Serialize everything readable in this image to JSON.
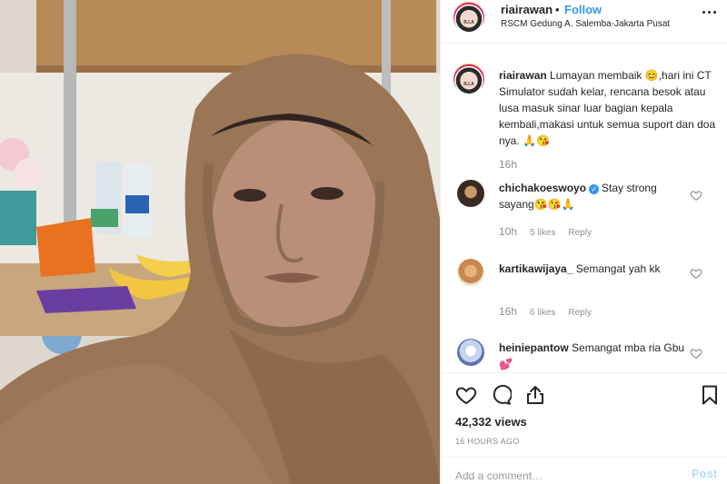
{
  "post": {
    "username": "riairawan",
    "follow_label": "Follow",
    "separator": "•",
    "location": "RSCM Gedung A. Salemba-Jakarta Pusat",
    "avatar_text": "R.I.A"
  },
  "caption": {
    "username": "riairawan",
    "text": "Lumayan membaik 😊,hari ini CT Simulator sudah kelar, rencana besok atau lusa masuk sinar luar bagian kepala kembali,makasi untuk semua suport dan doa nya. 🙏😘",
    "time": "16h"
  },
  "comments": [
    {
      "username": "chichakoeswoyo",
      "verified": true,
      "text": "Stay strong sayang😘😘🙏",
      "time": "10h",
      "likes": "5 likes",
      "reply": "Reply"
    },
    {
      "username": "kartikawijaya_",
      "verified": false,
      "text": "Semangat yah kk",
      "time": "16h",
      "likes": "6 likes",
      "reply": "Reply"
    },
    {
      "username": "heiniepantow",
      "verified": false,
      "text": "Semangat mba ria Gbu💕",
      "time": "",
      "likes": "",
      "reply": ""
    }
  ],
  "stats": {
    "views": "42,332 views",
    "posted": "16 HOURS AGO"
  },
  "composer": {
    "placeholder": "Add a comment…",
    "post_label": "Post"
  },
  "icons": {
    "like": "heart-icon",
    "comment": "comment-bubble-icon",
    "share": "share-icon",
    "save": "bookmark-icon",
    "more": "more-dots-icon"
  },
  "colors": {
    "link_blue": "#3897f0",
    "post_button_disabled": "#b2dffc",
    "muted_text": "#8e8e8e",
    "verified_blue": "#3897f0"
  }
}
